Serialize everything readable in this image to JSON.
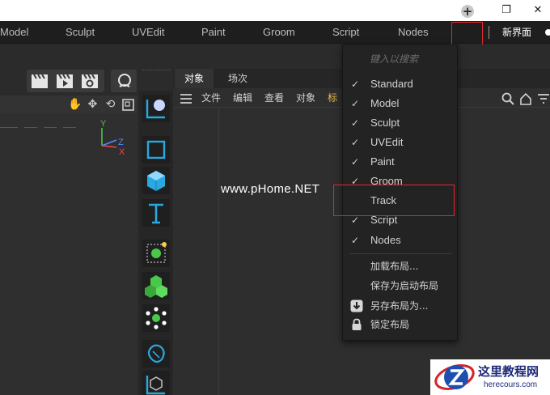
{
  "window": {
    "controls": {
      "restore": "❐",
      "close": "✕"
    }
  },
  "layout_tabs": [
    "Model",
    "Sculpt",
    "UVEdit",
    "Paint",
    "Groom",
    "Script",
    "Nodes"
  ],
  "new_layout_label": "新界面",
  "object_manager": {
    "tabs": [
      "对象",
      "场次"
    ],
    "menu": [
      "文件",
      "编辑",
      "查看",
      "对象",
      "标"
    ]
  },
  "dropdown": {
    "search_placeholder": "键入以搜索",
    "layouts": [
      {
        "label": "Standard",
        "checked": true
      },
      {
        "label": "Model",
        "checked": true
      },
      {
        "label": "Sculpt",
        "checked": true
      },
      {
        "label": "UVEdit",
        "checked": true
      },
      {
        "label": "Paint",
        "checked": true
      },
      {
        "label": "Groom",
        "checked": true
      },
      {
        "label": "Track",
        "checked": false
      },
      {
        "label": "Script",
        "checked": true
      },
      {
        "label": "Nodes",
        "checked": true
      }
    ],
    "actions": [
      {
        "label": "加载布局...",
        "icon": ""
      },
      {
        "label": "保存为启动布局",
        "icon": ""
      },
      {
        "label": "另存布局为...",
        "icon": "download-icon"
      },
      {
        "label": "锁定布局",
        "icon": "lock-icon"
      }
    ],
    "check_glyph": "✓"
  },
  "viewport": {
    "axes": {
      "y": "Y",
      "z": "Z",
      "x": "X"
    }
  },
  "watermark_text": "www.pHome.NET",
  "logo": {
    "title": "这里教程网",
    "url": "herecours.com"
  },
  "colors": {
    "accent_red": "#e0282e",
    "axis_y": "#4ec24e",
    "axis_z": "#4f8bff",
    "axis_x": "#e84a4a",
    "tool_cyan": "#2aa8e0",
    "tool_green": "#49c94a"
  }
}
